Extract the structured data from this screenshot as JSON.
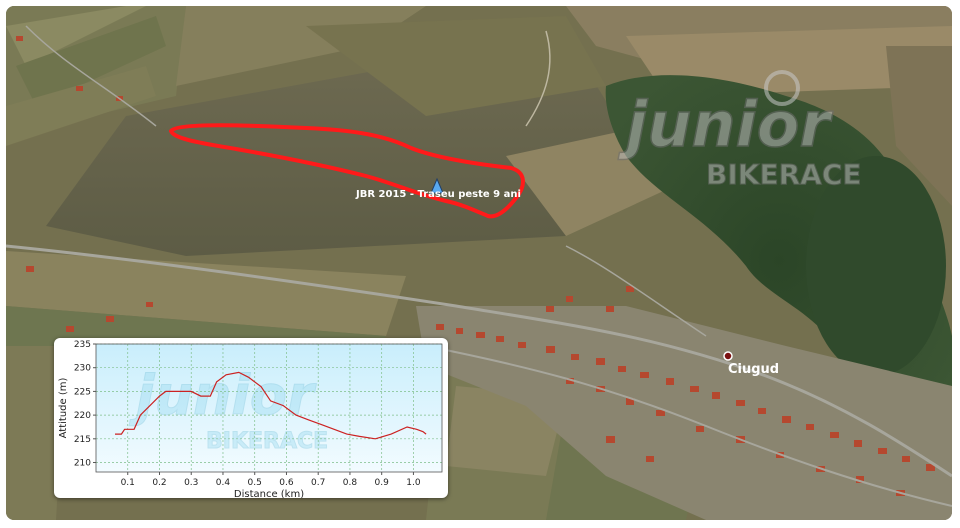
{
  "map": {
    "track_label": "JBR 2015 - Traseu peste 9 ani",
    "place_label": "Ciugud",
    "logo": {
      "word1": "junior",
      "word2": "BIKERACE"
    },
    "colors": {
      "track": "#ff1a1a",
      "field": "#6e6a50",
      "forest": "#2f4a2a",
      "road": "#9a9a92",
      "roof": "#b5482f"
    }
  },
  "chart_data": {
    "type": "line",
    "title": "",
    "xlabel": "Distance (km)",
    "ylabel": "Attitude (m)",
    "xlim": [
      0.0,
      1.09
    ],
    "ylim": [
      208,
      235
    ],
    "xticks": [
      "0.1",
      "0.2",
      "0.3",
      "0.4",
      "0.5",
      "0.6",
      "0.7",
      "0.8",
      "0.9",
      "1.0"
    ],
    "yticks": [
      "210",
      "215",
      "220",
      "225",
      "230",
      "235"
    ],
    "grid": true,
    "line_color": "#cc2222",
    "x": [
      0.06,
      0.08,
      0.09,
      0.12,
      0.14,
      0.17,
      0.2,
      0.22,
      0.25,
      0.3,
      0.33,
      0.36,
      0.38,
      0.41,
      0.45,
      0.48,
      0.52,
      0.55,
      0.59,
      0.63,
      0.67,
      0.71,
      0.75,
      0.79,
      0.83,
      0.88,
      0.93,
      0.98,
      1.01,
      1.03,
      1.04
    ],
    "y": [
      216,
      216,
      217,
      217,
      220,
      222,
      224,
      225,
      225,
      225,
      224,
      224,
      227,
      228.5,
      229,
      228,
      226,
      223,
      222,
      220,
      219,
      218,
      217,
      216,
      215.5,
      215,
      216,
      217.5,
      217,
      216.5,
      216
    ],
    "watermark": {
      "word1": "junior",
      "word2": "BIKERACE"
    }
  }
}
